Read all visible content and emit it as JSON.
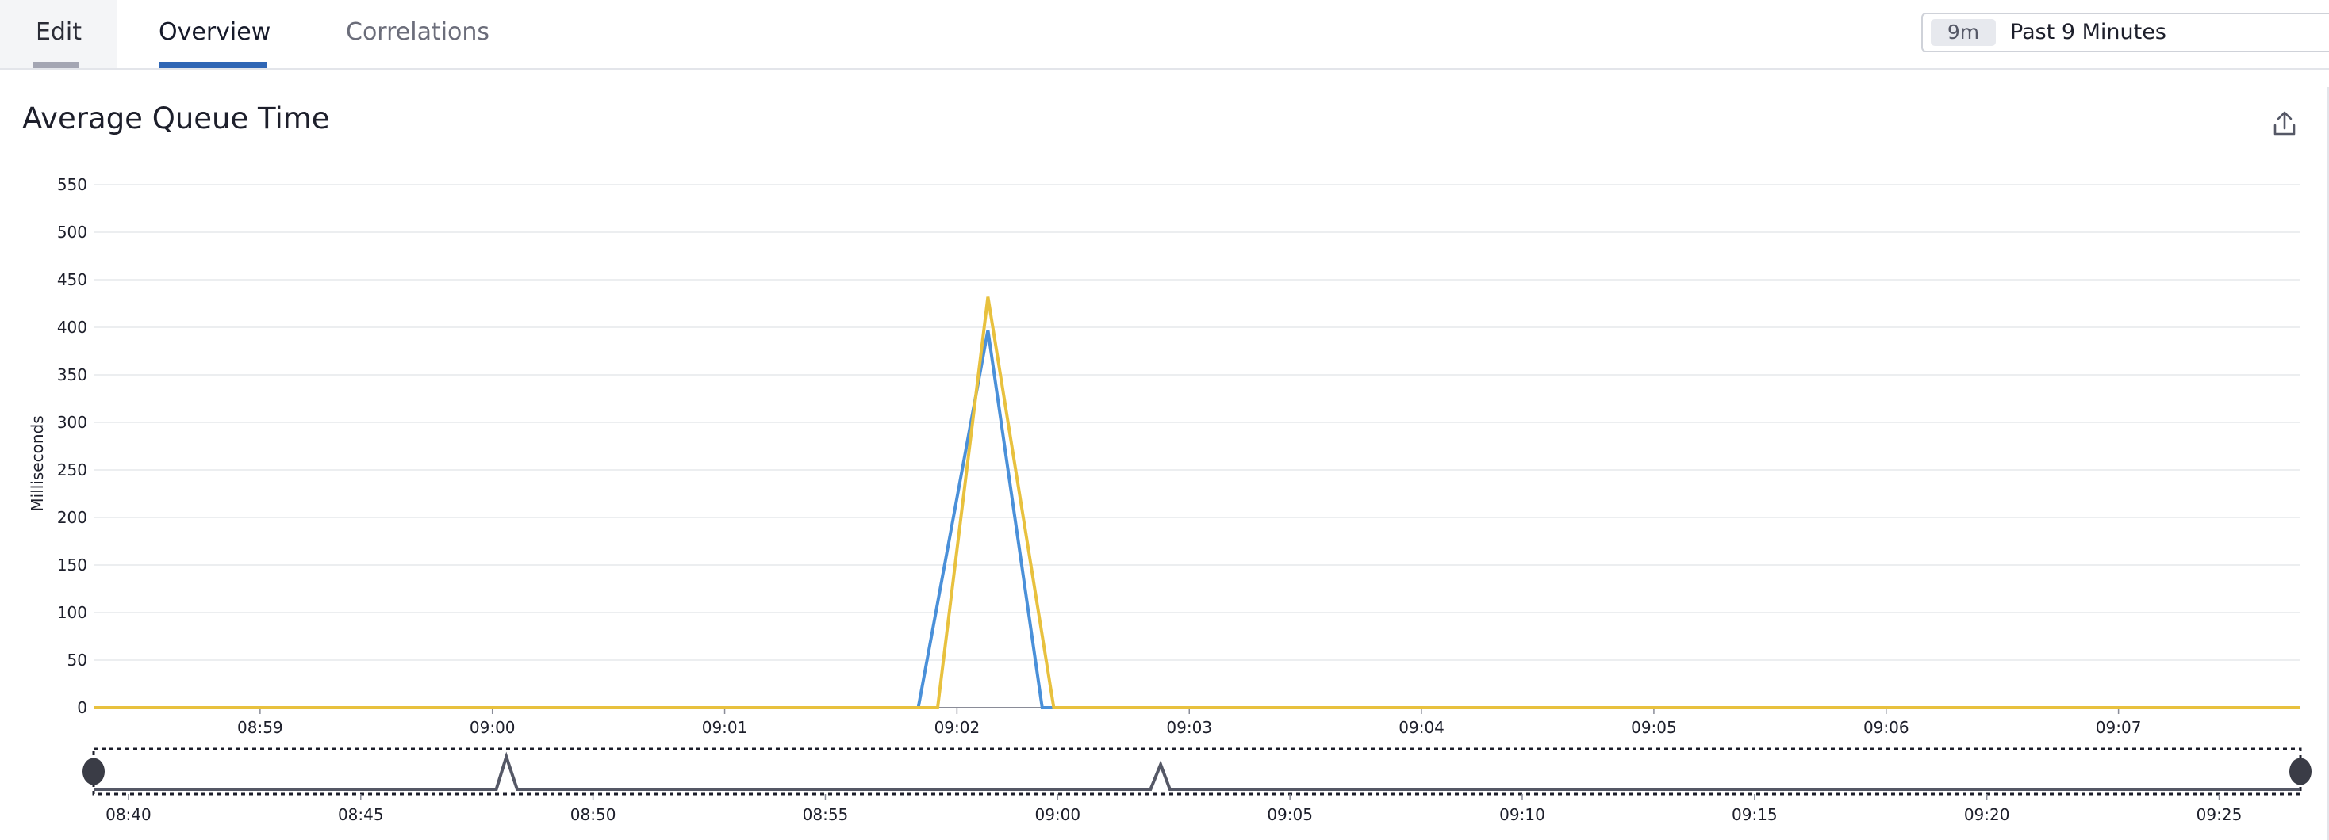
{
  "tabs": [
    {
      "label": "Edit"
    },
    {
      "label": "Overview",
      "active": true
    },
    {
      "label": "Correlations"
    }
  ],
  "time_picker": {
    "badge": "9m",
    "label": "Past 9 Minutes"
  },
  "panel": {
    "title": "Average Queue Time",
    "export_icon": "export-icon"
  },
  "colors": {
    "series_blue": "#4a90d9",
    "series_yellow": "#e8c13e",
    "tab_active": "#2f66b5",
    "brush_line": "#555866"
  },
  "chart_data": [
    {
      "type": "line",
      "title": "Average Queue Time",
      "ylabel": "Milliseconds",
      "xlabel": "",
      "ylim": [
        0,
        550
      ],
      "yticks": [
        0,
        50,
        100,
        150,
        200,
        250,
        300,
        350,
        400,
        450,
        500,
        550
      ],
      "grid": true,
      "xticks": [
        "08:59",
        "09:00",
        "09:01",
        "09:02",
        "09:03",
        "09:04",
        "09:05",
        "09:06",
        "09:07"
      ],
      "x_start": "08:58:17",
      "x_end": "09:07:47",
      "series": [
        {
          "color": "#4a90d9",
          "x": [
            "08:58:17",
            "09:01:50",
            "09:02:08",
            "09:02:22",
            "09:07:47"
          ],
          "y": [
            0,
            0,
            397,
            0,
            0
          ]
        },
        {
          "color": "#e8c13e",
          "x": [
            "08:58:17",
            "09:01:55",
            "09:02:08",
            "09:02:25",
            "09:07:47"
          ],
          "y": [
            0,
            0,
            432,
            0,
            0
          ]
        }
      ]
    },
    {
      "type": "line",
      "xticks": [
        "08:40",
        "08:45",
        "08:50",
        "08:55",
        "09:00",
        "09:05",
        "09:10",
        "09:15",
        "09:20",
        "09:25"
      ],
      "x_start": "08:39:15",
      "x_end": "09:26:45",
      "series": [
        {
          "color": "#555866",
          "x": [
            "08:39:15",
            "08:47:55",
            "08:48:08",
            "08:48:22",
            "09:02:00",
            "09:02:13",
            "09:02:25",
            "09:26:45"
          ],
          "y": [
            0,
            0,
            432,
            0,
            0,
            330,
            0,
            0
          ]
        }
      ]
    }
  ]
}
